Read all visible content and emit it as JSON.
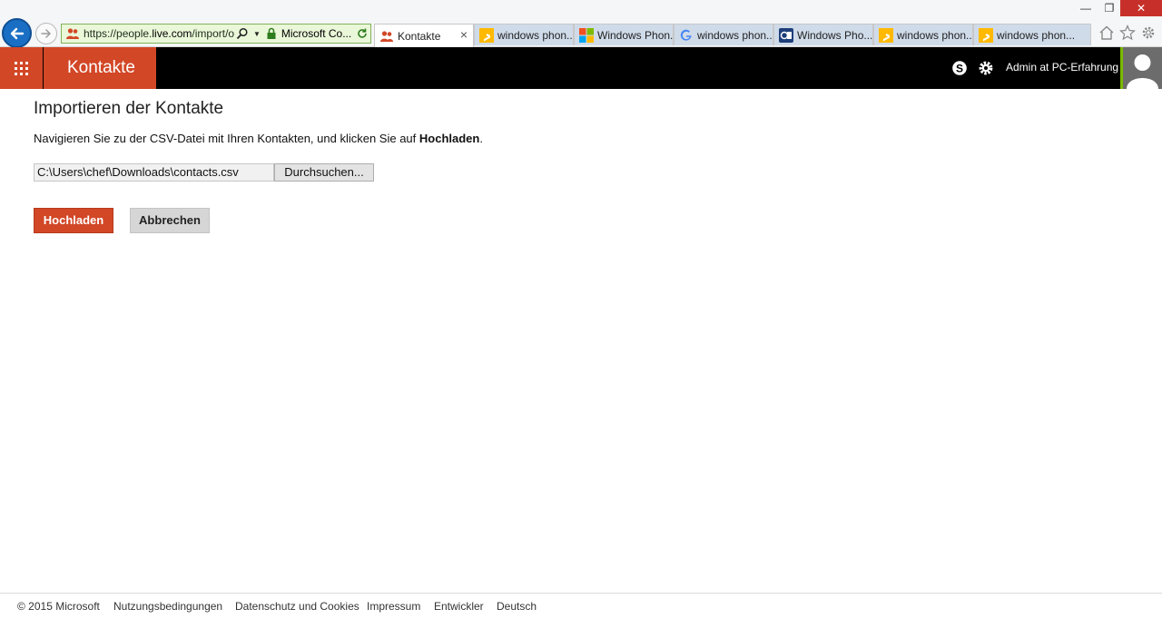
{
  "browser": {
    "url_prefix": "https://people.",
    "url_domain": "live.com",
    "url_rest": "/import/otl",
    "site_identity": "Microsoft Co...",
    "tabs": [
      {
        "label": "Kontakte",
        "icon": "people-icon",
        "active": true
      },
      {
        "label": "windows phon...",
        "icon": "bing-icon",
        "active": false
      },
      {
        "label": "Windows Phon...",
        "icon": "microsoft-logo-icon",
        "active": false
      },
      {
        "label": "windows phon...",
        "icon": "google-icon",
        "active": false
      },
      {
        "label": "Windows Pho...",
        "icon": "site-icon",
        "active": false
      },
      {
        "label": "windows phon...",
        "icon": "bing-icon",
        "active": false
      },
      {
        "label": "windows phon...",
        "icon": "bing-icon",
        "active": false
      }
    ],
    "tab_close_glyph": "×",
    "window_controls": {
      "minimize": "—",
      "restore": "❐",
      "close": "✕"
    }
  },
  "header": {
    "app_title": "Kontakte",
    "user_name": "Admin at PC-Erfahrung",
    "accent_color": "#d24726"
  },
  "main": {
    "title": "Importieren der Kontakte",
    "instruction_prefix": "Navigieren Sie zu der CSV-Datei mit Ihren Kontakten, und klicken Sie auf ",
    "instruction_bold": "Hochladen",
    "instruction_suffix": ".",
    "file_path": "C:\\Users\\chef\\Downloads\\contacts.csv",
    "browse_label": "Durchsuchen...",
    "upload_label": "Hochladen",
    "cancel_label": "Abbrechen"
  },
  "footer": {
    "copyright": "© 2015 Microsoft",
    "links": [
      "Nutzungsbedingungen",
      "Datenschutz und Cookies",
      "Impressum",
      "Entwickler",
      "Deutsch"
    ]
  }
}
